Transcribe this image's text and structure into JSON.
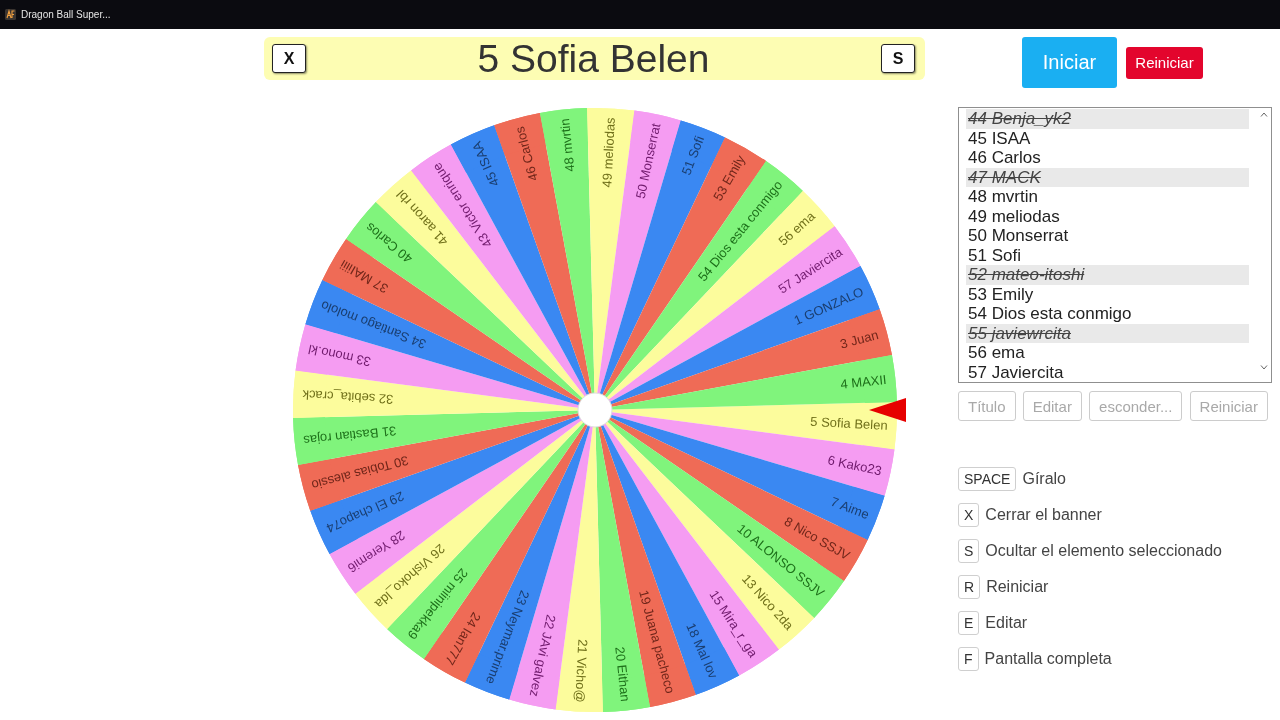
{
  "window": {
    "title": "Dragon Ball Super..."
  },
  "banner": {
    "close_key": "X",
    "title": "5 Sofia Belen",
    "hide_key": "S"
  },
  "wheel": {
    "segments": [
      {
        "label": "5 Sofia Belen",
        "color": "#fcfc9c"
      },
      {
        "label": "6 Kako23",
        "color": "#f59cf2"
      },
      {
        "label": "7 Aime",
        "color": "#3a88f2"
      },
      {
        "label": "8 Nico SSJV",
        "color": "#ef6b56"
      },
      {
        "label": "10 ALONSO SSJV",
        "color": "#80f47c"
      },
      {
        "label": "13 Nico 2da",
        "color": "#fcfc9c"
      },
      {
        "label": "15 Mira_r_ga",
        "color": "#f59cf2"
      },
      {
        "label": "18 Mal lov",
        "color": "#3a88f2"
      },
      {
        "label": "19 Juana pacheco",
        "color": "#ef6b56"
      },
      {
        "label": "20 Eithan",
        "color": "#80f47c"
      },
      {
        "label": "21 Vicho@",
        "color": "#fcfc9c"
      },
      {
        "label": "22 JAvi galvez",
        "color": "#f59cf2"
      },
      {
        "label": "23 Neymar.prime",
        "color": "#3a88f2"
      },
      {
        "label": "24 Ian777",
        "color": "#ef6b56"
      },
      {
        "label": "25 miinipekka9",
        "color": "#80f47c"
      },
      {
        "label": "26 Vishoko_lda",
        "color": "#fcfc9c"
      },
      {
        "label": "28 Yeremi6",
        "color": "#f59cf2"
      },
      {
        "label": "29 El chapo74",
        "color": "#3a88f2"
      },
      {
        "label": "30 Tobias alessio",
        "color": "#ef6b56"
      },
      {
        "label": "31 Bastian rojas",
        "color": "#80f47c"
      },
      {
        "label": "32 sebita_crack",
        "color": "#fcfc9c"
      },
      {
        "label": "33 mono.kl",
        "color": "#f59cf2"
      },
      {
        "label": "34 Santiago mololo",
        "color": "#3a88f2"
      },
      {
        "label": "37 MAIiiii",
        "color": "#ef6b56"
      },
      {
        "label": "40 Carlos",
        "color": "#80f47c"
      },
      {
        "label": "41 aaron rbl",
        "color": "#fcfc9c"
      },
      {
        "label": "43 Victor enrique",
        "color": "#f59cf2"
      },
      {
        "label": "45 ISAA",
        "color": "#3a88f2"
      },
      {
        "label": "46 Carlos",
        "color": "#ef6b56"
      },
      {
        "label": "48 mvrtin",
        "color": "#80f47c"
      },
      {
        "label": "49 meliodas",
        "color": "#fcfc9c"
      },
      {
        "label": "50 Monserrat",
        "color": "#f59cf2"
      },
      {
        "label": "51 Sofi",
        "color": "#3a88f2"
      },
      {
        "label": "53 Emily",
        "color": "#ef6b56"
      },
      {
        "label": "54 Dios esta conmigo",
        "color": "#80f47c"
      },
      {
        "label": "56 ema",
        "color": "#fcfc9c"
      },
      {
        "label": "57 Javiercita",
        "color": "#f59cf2"
      },
      {
        "label": "1 GONZALO",
        "color": "#3a88f2"
      },
      {
        "label": "3 Juan",
        "color": "#ef6b56"
      },
      {
        "label": "4 MAXII",
        "color": "#80f47c"
      }
    ]
  },
  "actions": [
    {
      "label": "Iniciar",
      "kind": "primary"
    },
    {
      "label": "Reiniciar",
      "kind": "danger"
    }
  ],
  "entries": [
    {
      "label": "44 Benja_yk2",
      "hidden": true
    },
    {
      "label": "45 ISAA",
      "hidden": false
    },
    {
      "label": "46 Carlos",
      "hidden": false
    },
    {
      "label": "47 MACK",
      "hidden": true
    },
    {
      "label": "48 mvrtin",
      "hidden": false
    },
    {
      "label": "49 meliodas",
      "hidden": false
    },
    {
      "label": "50 Monserrat",
      "hidden": false
    },
    {
      "label": "51 Sofi",
      "hidden": false
    },
    {
      "label": "52 mateo-itoshi",
      "hidden": true
    },
    {
      "label": "53 Emily",
      "hidden": false
    },
    {
      "label": "54 Dios esta conmigo",
      "hidden": false
    },
    {
      "label": "55 javiewrcita",
      "hidden": true
    },
    {
      "label": "56 ema",
      "hidden": false
    },
    {
      "label": "57 Javiercita",
      "hidden": false
    }
  ],
  "entry_buttons": [
    {
      "label": "Título",
      "disabled": true
    },
    {
      "label": "Editar",
      "disabled": true
    },
    {
      "label": "esconder...",
      "disabled": true
    },
    {
      "label": "Reiniciar",
      "disabled": true
    }
  ],
  "shortcuts": [
    {
      "key": "SPACE",
      "label": "Gíralo"
    },
    {
      "key": "X",
      "label": "Cerrar el banner"
    },
    {
      "key": "S",
      "label": "Ocultar el elemento seleccionado"
    },
    {
      "key": "R",
      "label": "Reiniciar"
    },
    {
      "key": "E",
      "label": "Editar"
    },
    {
      "key": "F",
      "label": "Pantalla completa"
    }
  ]
}
